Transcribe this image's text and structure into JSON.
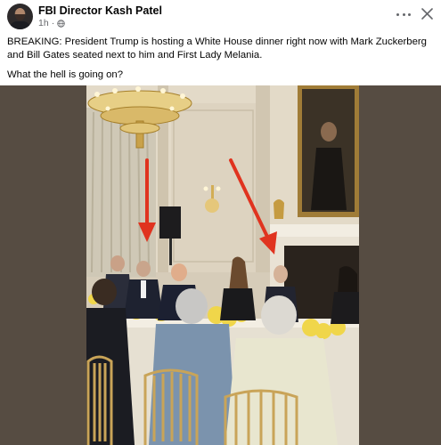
{
  "post": {
    "author": "FBI Director Kash Patel",
    "time": "1h",
    "separator": "·",
    "body_line1": "BREAKING: President Trump is hosting a White House dinner right now with Mark Zuckerberg",
    "body_line2": "and Bill Gates seated next to him and First Lady Melania.",
    "body_line3": "What the hell is going on?"
  },
  "icons": {
    "audience": "globe-icon",
    "menu": "more-options-icon",
    "dismiss": "close-icon"
  },
  "colors": {
    "text": "#050505",
    "secondary": "#65676b",
    "media_background": "#564c42",
    "annotation_arrow": "#e0331f"
  }
}
